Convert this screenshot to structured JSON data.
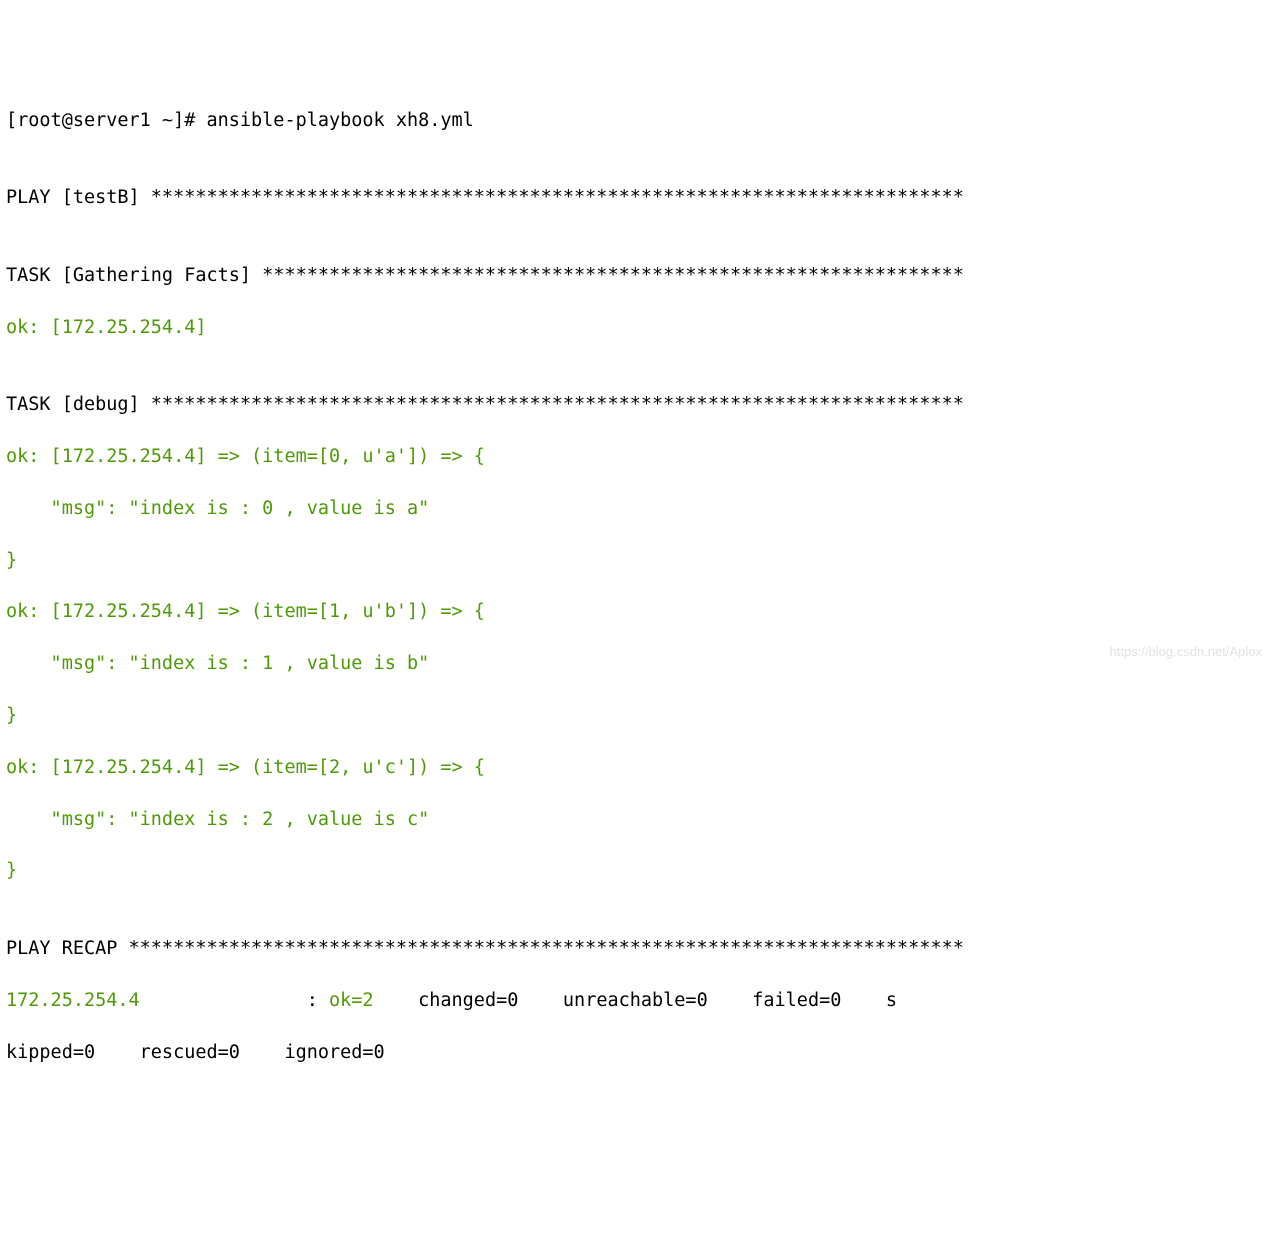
{
  "prompt": "[root@server1 ~]# ansible-playbook xh8.yml",
  "blank": "",
  "play_header": "PLAY [testB] *************************************************************************",
  "task1_header": "TASK [Gathering Facts] ***************************************************************",
  "task1_ok": "ok: [172.25.254.4]",
  "task2_header": "TASK [debug] *************************************************************************",
  "d0_l1": "ok: [172.25.254.4] => (item=[0, u'a']) => {",
  "d0_l2": "    \"msg\": \"index is : 0 , value is a\"",
  "d0_l3": "}",
  "d1_l1": "ok: [172.25.254.4] => (item=[1, u'b']) => {",
  "d1_l2": "    \"msg\": \"index is : 1 , value is b\"",
  "d1_l3": "}",
  "d2_l1": "ok: [172.25.254.4] => (item=[2, u'c']) => {",
  "d2_l2": "    \"msg\": \"index is : 2 , value is c\"",
  "d2_l3": "}",
  "recap_header": "PLAY RECAP ***************************************************************************",
  "recap_host": "172.25.254.4",
  "recap_sep": "               : ",
  "recap_ok": "ok=2   ",
  "recap_rest1": " changed=0    unreachable=0    failed=0    s",
  "recap_rest2": "kipped=0    rescued=0    ignored=0",
  "watermark": "https://blog.csdn.net/Aplox"
}
